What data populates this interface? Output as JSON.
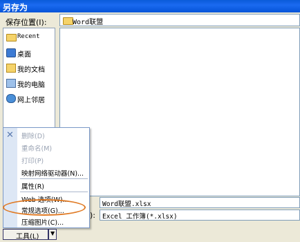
{
  "window": {
    "title": "另存为"
  },
  "savein": {
    "label": "保存位置(I):",
    "value": "Word联盟"
  },
  "places": [
    {
      "label": "Recent",
      "icon": "recent-folder-icon"
    },
    {
      "label": "桌面",
      "icon": "desktop-icon"
    },
    {
      "label": "我的文档",
      "icon": "my-documents-icon"
    },
    {
      "label": "我的电脑",
      "icon": "my-computer-icon"
    },
    {
      "label": "网上邻居",
      "icon": "network-icon"
    }
  ],
  "filename": {
    "value": "Word联盟.xlsx"
  },
  "filetype": {
    "label_tail": "):",
    "value": "Excel 工作簿(*.xlsx)"
  },
  "tools_menu": {
    "items": [
      {
        "label": "删除(D)",
        "enabled": false
      },
      {
        "label": "重命名(M)",
        "enabled": false
      },
      {
        "label": "打印(P)",
        "enabled": false
      },
      {
        "label": "映射网络驱动器(N)...",
        "enabled": true
      },
      {
        "label": "属性(R)",
        "enabled": true
      },
      {
        "label": "Web 选项(W)...",
        "enabled": true
      },
      {
        "label": "常规选项(G)...",
        "enabled": true,
        "highlighted": true
      },
      {
        "label": "压缩图片(C)...",
        "enabled": true
      }
    ]
  },
  "tools_button": {
    "label": "工具(L)"
  },
  "colors": {
    "title_bar": "#0a5bd9",
    "highlight_ring": "#e07a24"
  }
}
